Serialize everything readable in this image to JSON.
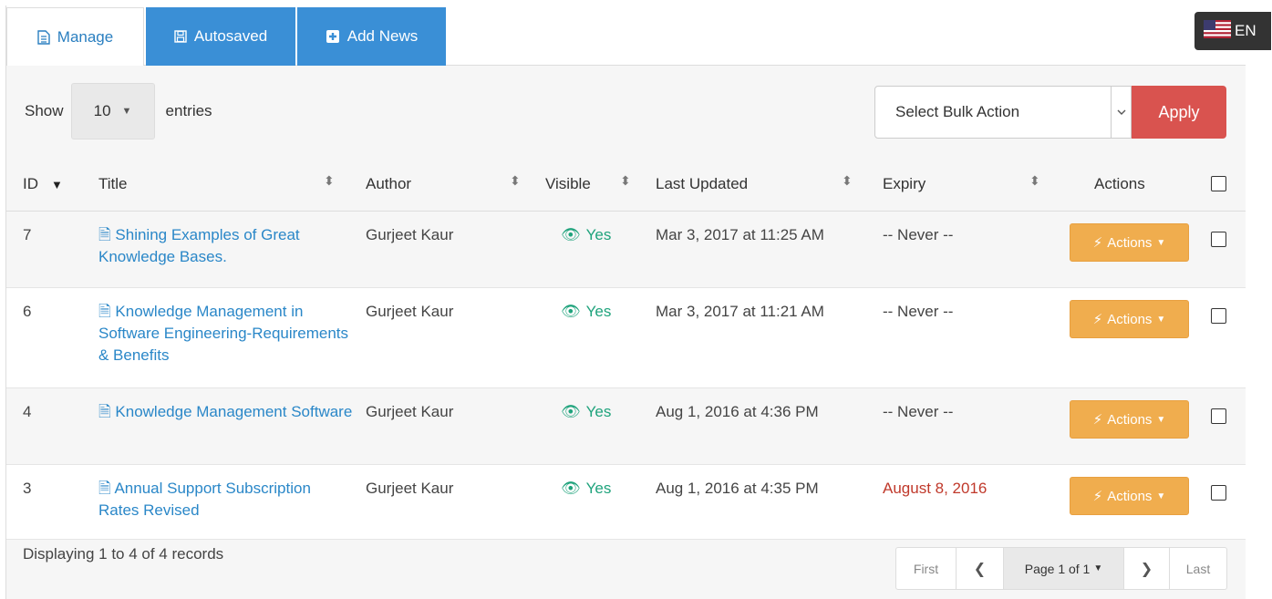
{
  "tabs": [
    {
      "label": "Manage",
      "icon": "document-icon"
    },
    {
      "label": "Autosaved",
      "icon": "floppy-disk-icon"
    },
    {
      "label": "Add News",
      "icon": "plus-square-icon"
    }
  ],
  "language": {
    "code": "EN",
    "flag": "us-flag-icon"
  },
  "length_control": {
    "show_label": "Show",
    "value": "10",
    "entries_label": "entries"
  },
  "bulk": {
    "selected": "Select Bulk Action",
    "apply_label": "Apply"
  },
  "columns": {
    "id": "ID",
    "title": "Title",
    "author": "Author",
    "visible": "Visible",
    "last_updated": "Last Updated",
    "expiry": "Expiry",
    "actions": "Actions"
  },
  "rows": [
    {
      "id": "7",
      "title": "Shining Examples of Great Knowledge Bases.",
      "author": "Gurjeet Kaur",
      "visible": "Yes",
      "last_updated": "Mar 3, 2017 at 11:25 AM",
      "expiry": "-- Never --",
      "action_label": "Actions"
    },
    {
      "id": "6",
      "title": "Knowledge Management in Software Engineering-Requirements & Benefits",
      "author": "Gurjeet Kaur",
      "visible": "Yes",
      "last_updated": "Mar 3, 2017 at 11:21 AM",
      "expiry": "-- Never --",
      "action_label": "Actions"
    },
    {
      "id": "4",
      "title": "Knowledge Management Software",
      "author": "Gurjeet Kaur",
      "visible": "Yes",
      "last_updated": "Aug 1, 2016 at 4:36 PM",
      "expiry": "-- Never --",
      "action_label": "Actions"
    },
    {
      "id": "3",
      "title": "Annual Support Subscription Rates Revised",
      "author": "Gurjeet Kaur",
      "visible": "Yes",
      "last_updated": "Aug 1, 2016 at 4:35 PM",
      "expiry": "August 8, 2016",
      "action_label": "Actions"
    }
  ],
  "footer": {
    "records_text": "Displaying 1 to 4 of 4 records",
    "pagination": {
      "first": "First",
      "page": "Page 1 of 1",
      "last": "Last"
    }
  },
  "colors": {
    "primary": "#3a8fd6",
    "danger": "#d9534f",
    "warning": "#f0ad4e",
    "link": "#2a87c8",
    "success": "#1fa37c",
    "expired": "#c0392b"
  }
}
